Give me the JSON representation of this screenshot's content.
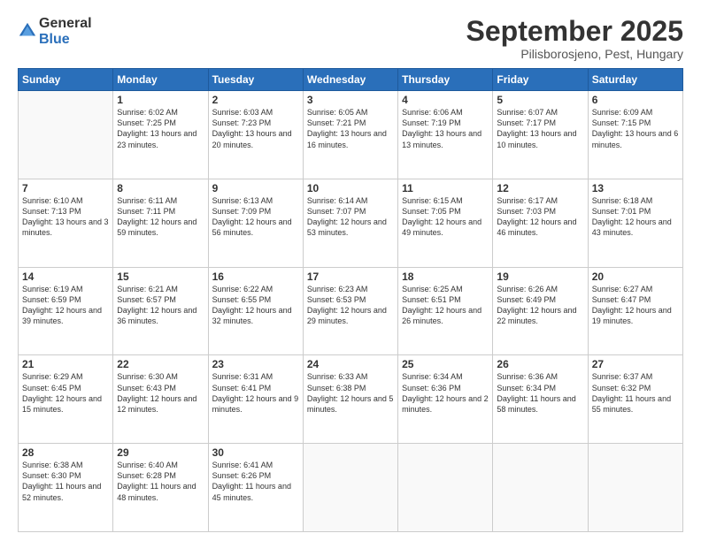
{
  "logo": {
    "general": "General",
    "blue": "Blue"
  },
  "title": "September 2025",
  "location": "Pilisborosjeno, Pest, Hungary",
  "weekdays": [
    "Sunday",
    "Monday",
    "Tuesday",
    "Wednesday",
    "Thursday",
    "Friday",
    "Saturday"
  ],
  "weeks": [
    [
      {
        "day": "",
        "sunrise": "",
        "sunset": "",
        "daylight": ""
      },
      {
        "day": "1",
        "sunrise": "Sunrise: 6:02 AM",
        "sunset": "Sunset: 7:25 PM",
        "daylight": "Daylight: 13 hours and 23 minutes."
      },
      {
        "day": "2",
        "sunrise": "Sunrise: 6:03 AM",
        "sunset": "Sunset: 7:23 PM",
        "daylight": "Daylight: 13 hours and 20 minutes."
      },
      {
        "day": "3",
        "sunrise": "Sunrise: 6:05 AM",
        "sunset": "Sunset: 7:21 PM",
        "daylight": "Daylight: 13 hours and 16 minutes."
      },
      {
        "day": "4",
        "sunrise": "Sunrise: 6:06 AM",
        "sunset": "Sunset: 7:19 PM",
        "daylight": "Daylight: 13 hours and 13 minutes."
      },
      {
        "day": "5",
        "sunrise": "Sunrise: 6:07 AM",
        "sunset": "Sunset: 7:17 PM",
        "daylight": "Daylight: 13 hours and 10 minutes."
      },
      {
        "day": "6",
        "sunrise": "Sunrise: 6:09 AM",
        "sunset": "Sunset: 7:15 PM",
        "daylight": "Daylight: 13 hours and 6 minutes."
      }
    ],
    [
      {
        "day": "7",
        "sunrise": "Sunrise: 6:10 AM",
        "sunset": "Sunset: 7:13 PM",
        "daylight": "Daylight: 13 hours and 3 minutes."
      },
      {
        "day": "8",
        "sunrise": "Sunrise: 6:11 AM",
        "sunset": "Sunset: 7:11 PM",
        "daylight": "Daylight: 12 hours and 59 minutes."
      },
      {
        "day": "9",
        "sunrise": "Sunrise: 6:13 AM",
        "sunset": "Sunset: 7:09 PM",
        "daylight": "Daylight: 12 hours and 56 minutes."
      },
      {
        "day": "10",
        "sunrise": "Sunrise: 6:14 AM",
        "sunset": "Sunset: 7:07 PM",
        "daylight": "Daylight: 12 hours and 53 minutes."
      },
      {
        "day": "11",
        "sunrise": "Sunrise: 6:15 AM",
        "sunset": "Sunset: 7:05 PM",
        "daylight": "Daylight: 12 hours and 49 minutes."
      },
      {
        "day": "12",
        "sunrise": "Sunrise: 6:17 AM",
        "sunset": "Sunset: 7:03 PM",
        "daylight": "Daylight: 12 hours and 46 minutes."
      },
      {
        "day": "13",
        "sunrise": "Sunrise: 6:18 AM",
        "sunset": "Sunset: 7:01 PM",
        "daylight": "Daylight: 12 hours and 43 minutes."
      }
    ],
    [
      {
        "day": "14",
        "sunrise": "Sunrise: 6:19 AM",
        "sunset": "Sunset: 6:59 PM",
        "daylight": "Daylight: 12 hours and 39 minutes."
      },
      {
        "day": "15",
        "sunrise": "Sunrise: 6:21 AM",
        "sunset": "Sunset: 6:57 PM",
        "daylight": "Daylight: 12 hours and 36 minutes."
      },
      {
        "day": "16",
        "sunrise": "Sunrise: 6:22 AM",
        "sunset": "Sunset: 6:55 PM",
        "daylight": "Daylight: 12 hours and 32 minutes."
      },
      {
        "day": "17",
        "sunrise": "Sunrise: 6:23 AM",
        "sunset": "Sunset: 6:53 PM",
        "daylight": "Daylight: 12 hours and 29 minutes."
      },
      {
        "day": "18",
        "sunrise": "Sunrise: 6:25 AM",
        "sunset": "Sunset: 6:51 PM",
        "daylight": "Daylight: 12 hours and 26 minutes."
      },
      {
        "day": "19",
        "sunrise": "Sunrise: 6:26 AM",
        "sunset": "Sunset: 6:49 PM",
        "daylight": "Daylight: 12 hours and 22 minutes."
      },
      {
        "day": "20",
        "sunrise": "Sunrise: 6:27 AM",
        "sunset": "Sunset: 6:47 PM",
        "daylight": "Daylight: 12 hours and 19 minutes."
      }
    ],
    [
      {
        "day": "21",
        "sunrise": "Sunrise: 6:29 AM",
        "sunset": "Sunset: 6:45 PM",
        "daylight": "Daylight: 12 hours and 15 minutes."
      },
      {
        "day": "22",
        "sunrise": "Sunrise: 6:30 AM",
        "sunset": "Sunset: 6:43 PM",
        "daylight": "Daylight: 12 hours and 12 minutes."
      },
      {
        "day": "23",
        "sunrise": "Sunrise: 6:31 AM",
        "sunset": "Sunset: 6:41 PM",
        "daylight": "Daylight: 12 hours and 9 minutes."
      },
      {
        "day": "24",
        "sunrise": "Sunrise: 6:33 AM",
        "sunset": "Sunset: 6:38 PM",
        "daylight": "Daylight: 12 hours and 5 minutes."
      },
      {
        "day": "25",
        "sunrise": "Sunrise: 6:34 AM",
        "sunset": "Sunset: 6:36 PM",
        "daylight": "Daylight: 12 hours and 2 minutes."
      },
      {
        "day": "26",
        "sunrise": "Sunrise: 6:36 AM",
        "sunset": "Sunset: 6:34 PM",
        "daylight": "Daylight: 11 hours and 58 minutes."
      },
      {
        "day": "27",
        "sunrise": "Sunrise: 6:37 AM",
        "sunset": "Sunset: 6:32 PM",
        "daylight": "Daylight: 11 hours and 55 minutes."
      }
    ],
    [
      {
        "day": "28",
        "sunrise": "Sunrise: 6:38 AM",
        "sunset": "Sunset: 6:30 PM",
        "daylight": "Daylight: 11 hours and 52 minutes."
      },
      {
        "day": "29",
        "sunrise": "Sunrise: 6:40 AM",
        "sunset": "Sunset: 6:28 PM",
        "daylight": "Daylight: 11 hours and 48 minutes."
      },
      {
        "day": "30",
        "sunrise": "Sunrise: 6:41 AM",
        "sunset": "Sunset: 6:26 PM",
        "daylight": "Daylight: 11 hours and 45 minutes."
      },
      {
        "day": "",
        "sunrise": "",
        "sunset": "",
        "daylight": ""
      },
      {
        "day": "",
        "sunrise": "",
        "sunset": "",
        "daylight": ""
      },
      {
        "day": "",
        "sunrise": "",
        "sunset": "",
        "daylight": ""
      },
      {
        "day": "",
        "sunrise": "",
        "sunset": "",
        "daylight": ""
      }
    ]
  ]
}
